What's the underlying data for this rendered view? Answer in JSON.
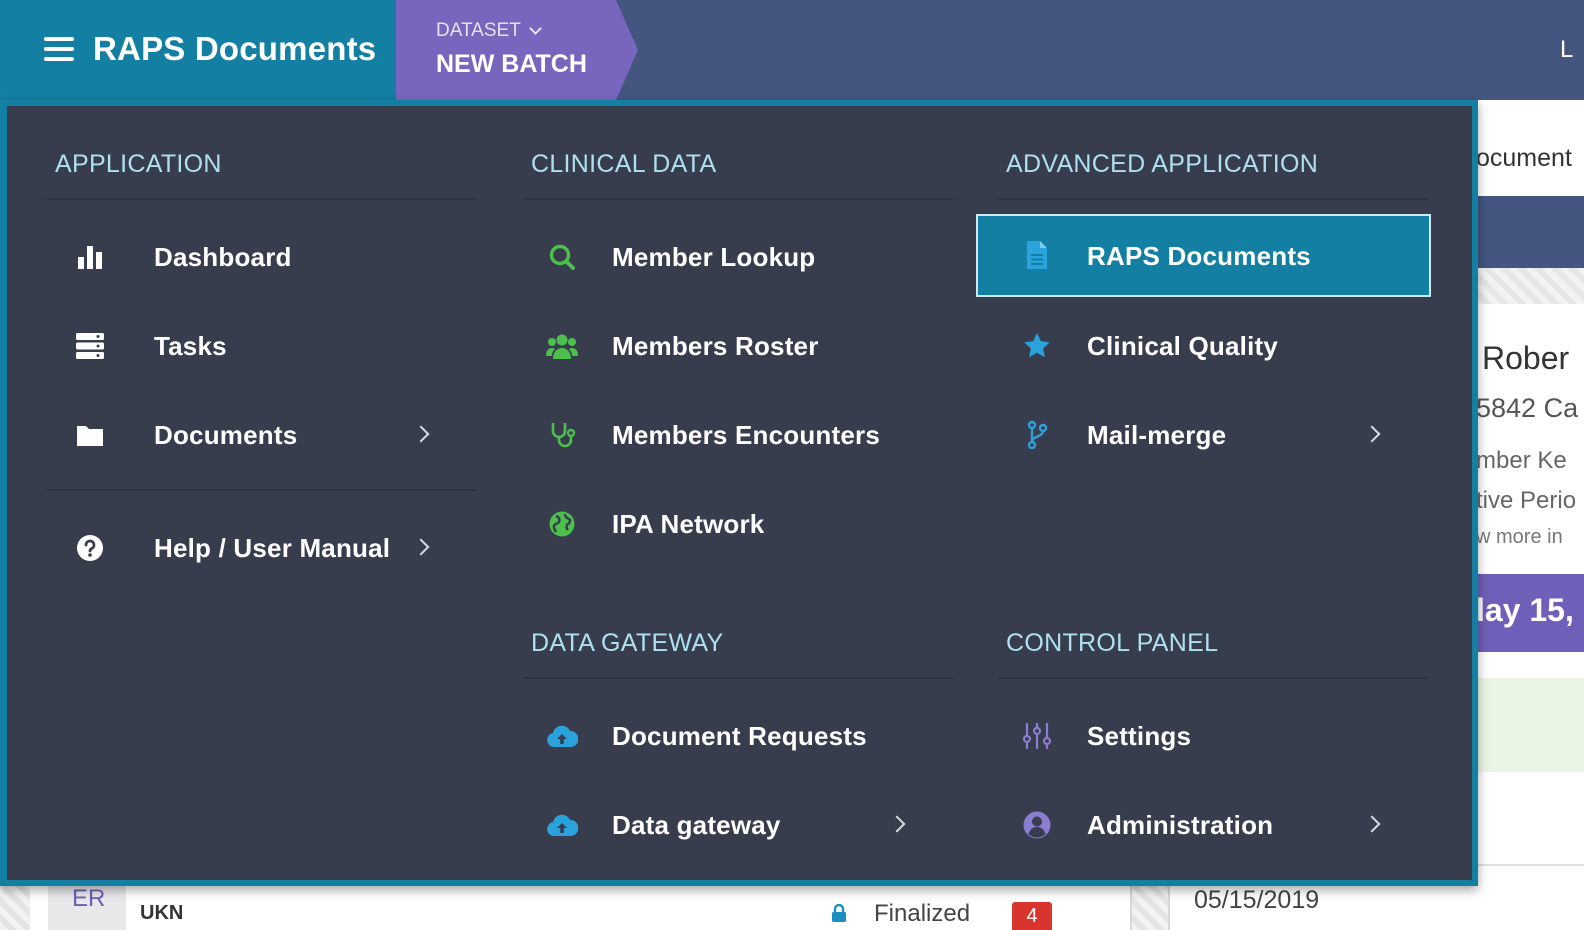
{
  "header": {
    "app_title": "RAPS Documents",
    "dataset_label": "DATASET",
    "dataset_value": "NEW BATCH",
    "edge_text": "L"
  },
  "menu": {
    "sections": {
      "application": {
        "title": "APPLICATION",
        "items": [
          {
            "label": "Dashboard",
            "icon": "bar-chart-icon"
          },
          {
            "label": "Tasks",
            "icon": "server-stack-icon"
          },
          {
            "label": "Documents",
            "icon": "folder-icon",
            "has_submenu": true
          },
          {
            "label": "Help / User Manual",
            "icon": "question-circle-icon",
            "has_submenu": true
          }
        ]
      },
      "clinical_data": {
        "title": "CLINICAL DATA",
        "items": [
          {
            "label": "Member Lookup",
            "icon": "search-icon"
          },
          {
            "label": "Members Roster",
            "icon": "users-icon"
          },
          {
            "label": "Members Encounters",
            "icon": "stethoscope-icon"
          },
          {
            "label": "IPA Network",
            "icon": "globe-icon"
          }
        ]
      },
      "advanced_application": {
        "title": "ADVANCED APPLICATION",
        "items": [
          {
            "label": "RAPS Documents",
            "icon": "file-text-icon",
            "active": true
          },
          {
            "label": "Clinical Quality",
            "icon": "star-icon"
          },
          {
            "label": "Mail-merge",
            "icon": "code-branch-icon",
            "has_submenu": true
          }
        ]
      },
      "data_gateway": {
        "title": "DATA GATEWAY",
        "items": [
          {
            "label": "Document Requests",
            "icon": "cloud-upload-icon"
          },
          {
            "label": "Data gateway",
            "icon": "cloud-upload-icon",
            "has_submenu": true
          }
        ]
      },
      "control_panel": {
        "title": "CONTROL PANEL",
        "items": [
          {
            "label": "Settings",
            "icon": "sliders-icon"
          },
          {
            "label": "Administration",
            "icon": "user-circle-icon",
            "has_submenu": true
          }
        ]
      }
    }
  },
  "background": {
    "doc_title_fragment": "ocument",
    "name_fragment": "Rober",
    "line1": "5842 Ca",
    "line2": "mber Ke",
    "line3": "tive Perio",
    "line4": "w more in",
    "date_big": "lay 15,",
    "row_tag": "ER",
    "row_ukn": "UKN",
    "row_status": "Finalized",
    "row_badge": "4",
    "row_date": "05/15/2019"
  },
  "colors": {
    "brand_teal": "#137fa3",
    "dataset_purple": "#7866be",
    "topbar_navy": "#44557f",
    "menu_bg": "#383d4e",
    "section_heading": "#aee0ef",
    "icon_green": "#4cbf4c",
    "icon_blue": "#2aa3dc",
    "icon_purple": "#8a7ed0"
  }
}
